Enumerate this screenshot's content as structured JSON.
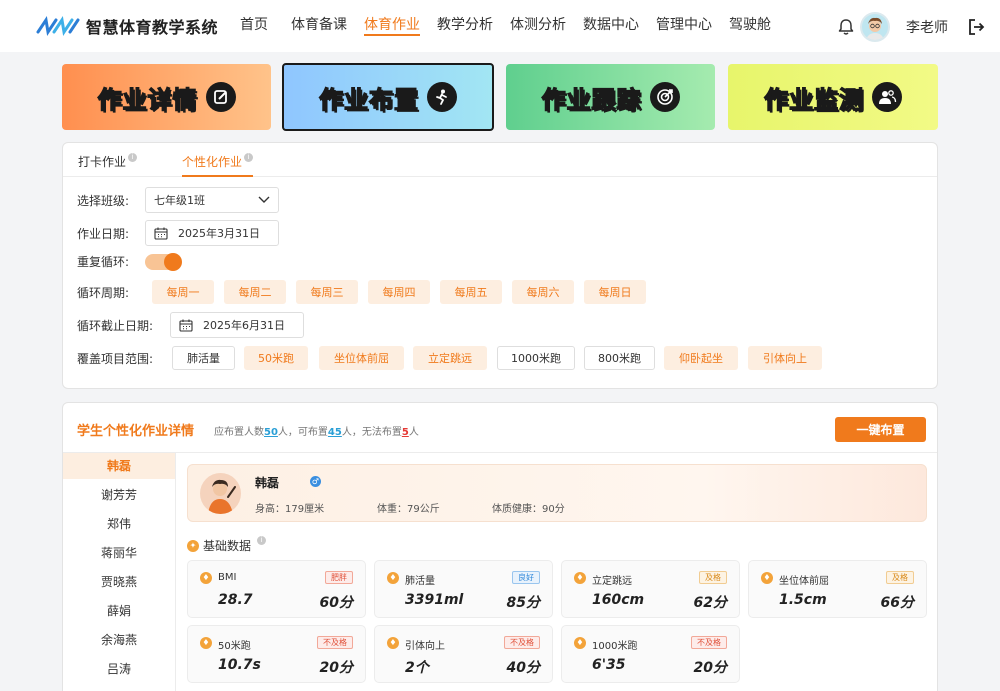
{
  "app": {
    "title": "智慧体育教学系统"
  },
  "nav": [
    {
      "label": "首页",
      "active": false
    },
    {
      "label": "体育备课",
      "active": false
    },
    {
      "label": "体育作业",
      "active": true
    },
    {
      "label": "教学分析",
      "active": false
    },
    {
      "label": "体测分析",
      "active": false
    },
    {
      "label": "数据中心",
      "active": false
    },
    {
      "label": "管理中心",
      "active": false
    },
    {
      "label": "驾驶舱",
      "active": false
    }
  ],
  "user": {
    "name": "李老师"
  },
  "banners": [
    {
      "label": "作业详情",
      "icon": "edit-icon"
    },
    {
      "label": "作业布置",
      "icon": "runner-icon",
      "selected": true
    },
    {
      "label": "作业跟踪",
      "icon": "target-icon"
    },
    {
      "label": "作业监测",
      "icon": "users-icon"
    }
  ],
  "tabs": [
    {
      "label": "打卡作业",
      "active": false
    },
    {
      "label": "个性化作业",
      "active": true
    }
  ],
  "form": {
    "class_label": "选择班级:",
    "class_value": "七年级1班",
    "date_label": "作业日期:",
    "date_value": "2025年3月31日",
    "repeat_label": "重复循环:",
    "repeat_on": true,
    "cycle_label": "循环周期:",
    "cycle_days": [
      "每周一",
      "每周二",
      "每周三",
      "每周四",
      "每周五",
      "每周六",
      "每周日"
    ],
    "end_label": "循环截止日期:",
    "end_value": "2025年6月31日",
    "scope_label": "覆盖项目范围:",
    "scope_items": [
      {
        "label": "肺活量",
        "selected": false
      },
      {
        "label": "50米跑",
        "selected": true
      },
      {
        "label": "坐位体前屈",
        "selected": true
      },
      {
        "label": "立定跳远",
        "selected": true
      },
      {
        "label": "1000米跑",
        "selected": false
      },
      {
        "label": "800米跑",
        "selected": false
      },
      {
        "label": "仰卧起坐",
        "selected": true
      },
      {
        "label": "引体向上",
        "selected": true
      }
    ]
  },
  "details": {
    "title": "学生个性化作业详情",
    "stats": {
      "prefix": "应布置人数",
      "total": "50",
      "mid1": "人，可布置",
      "can": "45",
      "mid2": "人，无法布置",
      "cannot": "5",
      "suffix": "人"
    },
    "assign_label": "一键布置",
    "students": [
      "韩磊",
      "谢芳芳",
      "郑伟",
      "蒋丽华",
      "贾晓燕",
      "薛娟",
      "余海燕",
      "吕涛"
    ],
    "profile": {
      "name": "韩磊",
      "gender_symbol": "♂",
      "height": "身高：179厘米",
      "weight": "体重：79公斤",
      "health": "体质健康：90分"
    },
    "section_title": "基础数据",
    "metrics": [
      {
        "name": "BMI",
        "badge": "肥胖",
        "tone": "red",
        "value": "28.7",
        "score": "60分"
      },
      {
        "name": "肺活量",
        "badge": "良好",
        "tone": "blue",
        "value": "3391ml",
        "score": "85分"
      },
      {
        "name": "立定跳远",
        "badge": "及格",
        "tone": "gold",
        "value": "160cm",
        "score": "62分"
      },
      {
        "name": "坐位体前屈",
        "badge": "及格",
        "tone": "gold",
        "value": "1.5cm",
        "score": "66分"
      },
      {
        "name": "50米跑",
        "badge": "不及格",
        "tone": "red",
        "value": "10.7s",
        "score": "20分"
      },
      {
        "name": "引体向上",
        "badge": "不及格",
        "tone": "red",
        "value": "2个",
        "score": "40分"
      },
      {
        "name": "1000米跑",
        "badge": "不及格",
        "tone": "red",
        "value": "6'35",
        "score": "20分"
      }
    ]
  }
}
